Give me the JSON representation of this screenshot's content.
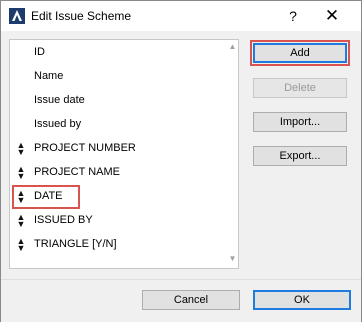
{
  "window": {
    "title": "Edit Issue Scheme",
    "help_label": "?",
    "close_label": "✕"
  },
  "list": {
    "items": [
      {
        "label": "ID",
        "movable": false
      },
      {
        "label": "Name",
        "movable": false
      },
      {
        "label": "Issue date",
        "movable": false
      },
      {
        "label": "Issued by",
        "movable": false
      },
      {
        "label": "PROJECT NUMBER",
        "movable": true
      },
      {
        "label": "PROJECT NAME",
        "movable": true
      },
      {
        "label": "DATE",
        "movable": true,
        "highlighted": true
      },
      {
        "label": "ISSUED BY",
        "movable": true
      },
      {
        "label": "TRIANGLE [Y/N]",
        "movable": true
      }
    ],
    "handle_glyph": "▲▼"
  },
  "buttons": {
    "add": "Add",
    "delete": "Delete",
    "import": "Import...",
    "export": "Export...",
    "cancel": "Cancel",
    "ok": "OK"
  },
  "colors": {
    "highlight": "#d9534f",
    "default_button_border": "#1e7be0",
    "dialog_background": "#f0f0f0"
  }
}
